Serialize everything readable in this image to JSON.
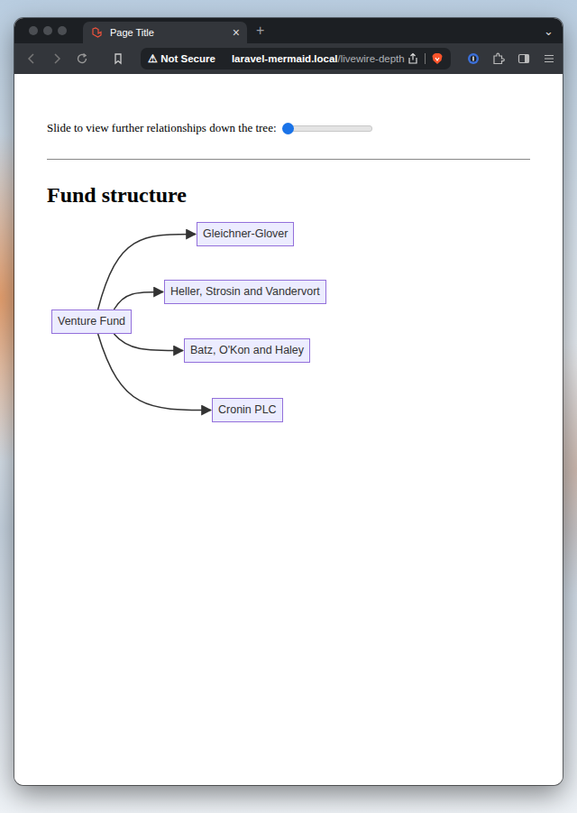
{
  "tabs": [
    {
      "label": "Page Title",
      "selected": true,
      "close": "×"
    }
  ],
  "new_tab": "+",
  "tab_menu": "⌄",
  "address_bar": {
    "security_icon": "⚠",
    "security": "Not Secure",
    "host": "laravel-mermaid.local",
    "path": "/livewire-depth"
  },
  "page": {
    "slider_label": "Slide to view further relationships down the tree:",
    "slider": {
      "level": 0
    },
    "heading": "Fund structure"
  },
  "diagram": {
    "nodes": [
      {
        "label": "Venture Fund"
      },
      {
        "label": "Gleichner-Glover"
      },
      {
        "label": "Heller, Strosin and Vandervort"
      },
      {
        "label": "Batz, O'Kon and Haley"
      },
      {
        "label": "Cronin PLC"
      }
    ],
    "edges": [
      {
        "from": 0,
        "to": 1
      },
      {
        "from": 0,
        "to": 2
      },
      {
        "from": 0,
        "to": 3
      },
      {
        "from": 0,
        "to": 4
      }
    ]
  }
}
